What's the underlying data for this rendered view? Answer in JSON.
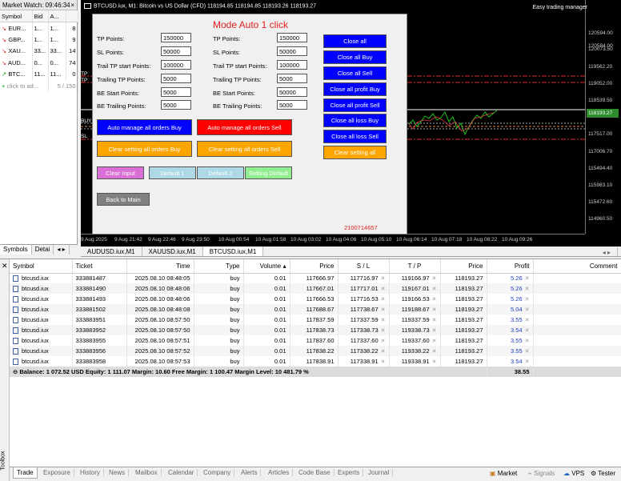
{
  "market_watch": {
    "title": "Market Watch: 09:46:34",
    "close": "×",
    "headers": [
      "Symbol",
      "Bid",
      "A...",
      ""
    ],
    "rows": [
      {
        "dir": "↘",
        "symbol": "EUR...",
        "bid": "1...",
        "ask": "1...",
        "spread": "8"
      },
      {
        "dir": "↘",
        "symbol": "GBP...",
        "bid": "1...",
        "ask": "1...",
        "spread": "9"
      },
      {
        "dir": "↘",
        "symbol": "XAU...",
        "bid": "33...",
        "ask": "33...",
        "spread": "14"
      },
      {
        "dir": "↘",
        "symbol": "AUD...",
        "bid": "0...",
        "ask": "0...",
        "spread": "74"
      },
      {
        "dir": "↗",
        "symbol": "BTC...",
        "bid": "11...",
        "ask": "11...",
        "spread": "0"
      }
    ],
    "add_label": "click to ad...",
    "count": "5 / 150",
    "tabs": [
      "Symbols",
      "Detai"
    ]
  },
  "chart": {
    "title": "BTCUSD.iux, M1:  Bitcoin vs US Dollar (CFD)  118194.85 118194.85 118193.26 118193.27",
    "easy": "Easy trading manager",
    "prices": [
      "120594.00",
      "120584.00",
      "120073.50",
      "119562.20",
      "119052.00",
      "118539.50",
      "118193.27",
      "117517.00",
      "117006.70",
      "115494.40",
      "115983.10",
      "115472.60",
      "114960.50"
    ],
    "current_price": "118193.27",
    "times": [
      "9 Aug 2025",
      "9 Aug 21:42",
      "9 Aug 22:46",
      "9 Aug 23:50",
      "10 Aug 00:54",
      "10 Aug 01:58",
      "10 Aug 03:02",
      "10 Aug 04:06",
      "10 Aug 05:10",
      "10 Aug 06:14",
      "10 Aug 07:18",
      "10 Aug 08:22",
      "10 Aug 09:26"
    ],
    "line_labels": [
      "TP",
      "TP",
      "BUY",
      "SL"
    ],
    "tabs": [
      "AUDUSD.iux,M1",
      "XAUUSD.iux,M1",
      "BTCUSD.iux,M1"
    ],
    "active_tab": "BTCUSD.iux,M1"
  },
  "panel": {
    "title": "Mode Auto 1 click",
    "left_fields": [
      {
        "label": "TP Points:",
        "value": "150000"
      },
      {
        "label": "SL Points:",
        "value": "50000"
      },
      {
        "label": "Trail TP start Points:",
        "value": "100000"
      },
      {
        "label": "Trailing TP Points:",
        "value": "5000"
      },
      {
        "label": "BE Start Points:",
        "value": "5000"
      },
      {
        "label": "BE Trailing Points:",
        "value": "5000"
      }
    ],
    "mid_fields": [
      {
        "label": "TP Points:",
        "value": "150000"
      },
      {
        "label": "SL Points:",
        "value": "50000"
      },
      {
        "label": "Trail TP start Points:",
        "value": "100000"
      },
      {
        "label": "Trailing TP Points:",
        "value": "5000"
      },
      {
        "label": "BE Start Points:",
        "value": "50000"
      },
      {
        "label": "BE Trailing Points:",
        "value": "5000"
      }
    ],
    "right_buttons": [
      "Close all",
      "Close all Buy",
      "Close all Sell",
      "Close all profit Buy",
      "Close all profit Sell",
      "Close all loss Buy",
      "Close all loss Sell",
      "Clear setting all"
    ],
    "auto_buy": "Auto manage all orders Buy",
    "auto_sell": "Auto manage all orders Sell",
    "clear_buy": "Clear setting all orders Buy",
    "clear_sell": "Clear setting all orders Sell",
    "clear_input": "Clear Input",
    "default1": "Default 1",
    "default2": "Default 2",
    "setting_default": "Setting Default",
    "back": "Back to Main",
    "code": "2100714657"
  },
  "trade": {
    "headers": {
      "symbol": "Symbol",
      "ticket": "Ticket",
      "time": "Time",
      "type": "Type",
      "volume": "Volume",
      "price": "Price",
      "sl": "S / L",
      "tp": "T / P",
      "price2": "Price",
      "profit": "Profit",
      "comment": "Comment"
    },
    "rows": [
      {
        "symbol": "btcusd.iux",
        "ticket": "333881487",
        "time": "2025.08.10 08:48:05",
        "type": "buy",
        "volume": "0.01",
        "price": "117666.97",
        "sl": "117716.97",
        "tp": "119166.97",
        "cur": "118193.27",
        "profit": "5.26"
      },
      {
        "symbol": "btcusd.iux",
        "ticket": "333881490",
        "time": "2025.08.10 08:48:06",
        "type": "buy",
        "volume": "0.01",
        "price": "117667.01",
        "sl": "117717.01",
        "tp": "119167.01",
        "cur": "118193.27",
        "profit": "5.26"
      },
      {
        "symbol": "btcusd.iux",
        "ticket": "333881493",
        "time": "2025.08.10 08:48:06",
        "type": "buy",
        "volume": "0.01",
        "price": "117666.53",
        "sl": "117716.53",
        "tp": "119166.53",
        "cur": "118193.27",
        "profit": "5.26"
      },
      {
        "symbol": "btcusd.iux",
        "ticket": "333881502",
        "time": "2025.08.10 08:48:08",
        "type": "buy",
        "volume": "0.01",
        "price": "117688.67",
        "sl": "117738.67",
        "tp": "119188.67",
        "cur": "118193.27",
        "profit": "5.04"
      },
      {
        "symbol": "btcusd.iux",
        "ticket": "333883951",
        "time": "2025.08.10 08:57:50",
        "type": "buy",
        "volume": "0.01",
        "price": "117837.59",
        "sl": "117337.59",
        "tp": "119337.59",
        "cur": "118193.27",
        "profit": "3.55"
      },
      {
        "symbol": "btcusd.iux",
        "ticket": "333883952",
        "time": "2025.08.10 08:57:50",
        "type": "buy",
        "volume": "0.01",
        "price": "117838.73",
        "sl": "117338.73",
        "tp": "119338.73",
        "cur": "118193.27",
        "profit": "3.54"
      },
      {
        "symbol": "btcusd.iux",
        "ticket": "333883955",
        "time": "2025.08.10 08:57:51",
        "type": "buy",
        "volume": "0.01",
        "price": "117837.60",
        "sl": "117337.60",
        "tp": "119337.60",
        "cur": "118193.27",
        "profit": "3.55"
      },
      {
        "symbol": "btcusd.iux",
        "ticket": "333883956",
        "time": "2025.08.10 08:57:52",
        "type": "buy",
        "volume": "0.01",
        "price": "117838.22",
        "sl": "117338.22",
        "tp": "119338.22",
        "cur": "118193.27",
        "profit": "3.55"
      },
      {
        "symbol": "btcusd.iux",
        "ticket": "333883958",
        "time": "2025.08.10 08:57:53",
        "type": "buy",
        "volume": "0.01",
        "price": "117838.91",
        "sl": "117338.91",
        "tp": "119338.91",
        "cur": "118193.27",
        "profit": "3.54"
      }
    ],
    "balance": "Balance: 1 072.52 USD  Equity: 1 111.07  Margin: 10.60  Free Margin: 1 100.47  Margin Level: 10 481.79 %",
    "total_profit": "38.55"
  },
  "toolbox": {
    "side_label": "Toolbox",
    "tabs": [
      "Trade",
      "Exposure",
      "History",
      "News",
      "Mailbox",
      "Calendar",
      "Company",
      "Alerts",
      "Articles",
      "Code Base",
      "Experts",
      "Journal"
    ],
    "right": [
      "Market",
      "Signals",
      "VPS",
      "Tester"
    ]
  }
}
